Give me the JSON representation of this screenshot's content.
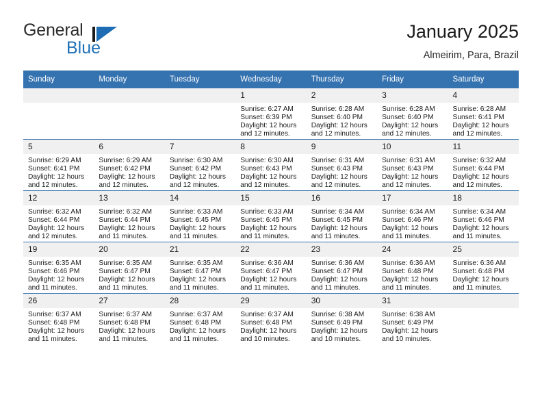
{
  "brand": {
    "name_primary": "General",
    "name_secondary": "Blue",
    "mark_icon": "triangle-flag-icon"
  },
  "header": {
    "title": "January 2025",
    "subtitle": "Almeirim, Para, Brazil"
  },
  "theme": {
    "header_blue": "#3572b0",
    "brand_blue": "#1d70b7",
    "daynum_bg": "#f0f0f0",
    "text": "#1a1a1a"
  },
  "weekday_headers": [
    "Sunday",
    "Monday",
    "Tuesday",
    "Wednesday",
    "Thursday",
    "Friday",
    "Saturday"
  ],
  "weeks": [
    [
      {
        "day": "",
        "blank": true
      },
      {
        "day": "",
        "blank": true
      },
      {
        "day": "",
        "blank": true
      },
      {
        "day": "1",
        "sunrise": "Sunrise: 6:27 AM",
        "sunset": "Sunset: 6:39 PM",
        "daylight": "Daylight: 12 hours and 12 minutes."
      },
      {
        "day": "2",
        "sunrise": "Sunrise: 6:28 AM",
        "sunset": "Sunset: 6:40 PM",
        "daylight": "Daylight: 12 hours and 12 minutes."
      },
      {
        "day": "3",
        "sunrise": "Sunrise: 6:28 AM",
        "sunset": "Sunset: 6:40 PM",
        "daylight": "Daylight: 12 hours and 12 minutes."
      },
      {
        "day": "4",
        "sunrise": "Sunrise: 6:28 AM",
        "sunset": "Sunset: 6:41 PM",
        "daylight": "Daylight: 12 hours and 12 minutes."
      }
    ],
    [
      {
        "day": "5",
        "sunrise": "Sunrise: 6:29 AM",
        "sunset": "Sunset: 6:41 PM",
        "daylight": "Daylight: 12 hours and 12 minutes."
      },
      {
        "day": "6",
        "sunrise": "Sunrise: 6:29 AM",
        "sunset": "Sunset: 6:42 PM",
        "daylight": "Daylight: 12 hours and 12 minutes."
      },
      {
        "day": "7",
        "sunrise": "Sunrise: 6:30 AM",
        "sunset": "Sunset: 6:42 PM",
        "daylight": "Daylight: 12 hours and 12 minutes."
      },
      {
        "day": "8",
        "sunrise": "Sunrise: 6:30 AM",
        "sunset": "Sunset: 6:43 PM",
        "daylight": "Daylight: 12 hours and 12 minutes."
      },
      {
        "day": "9",
        "sunrise": "Sunrise: 6:31 AM",
        "sunset": "Sunset: 6:43 PM",
        "daylight": "Daylight: 12 hours and 12 minutes."
      },
      {
        "day": "10",
        "sunrise": "Sunrise: 6:31 AM",
        "sunset": "Sunset: 6:43 PM",
        "daylight": "Daylight: 12 hours and 12 minutes."
      },
      {
        "day": "11",
        "sunrise": "Sunrise: 6:32 AM",
        "sunset": "Sunset: 6:44 PM",
        "daylight": "Daylight: 12 hours and 12 minutes."
      }
    ],
    [
      {
        "day": "12",
        "sunrise": "Sunrise: 6:32 AM",
        "sunset": "Sunset: 6:44 PM",
        "daylight": "Daylight: 12 hours and 12 minutes."
      },
      {
        "day": "13",
        "sunrise": "Sunrise: 6:32 AM",
        "sunset": "Sunset: 6:44 PM",
        "daylight": "Daylight: 12 hours and 11 minutes."
      },
      {
        "day": "14",
        "sunrise": "Sunrise: 6:33 AM",
        "sunset": "Sunset: 6:45 PM",
        "daylight": "Daylight: 12 hours and 11 minutes."
      },
      {
        "day": "15",
        "sunrise": "Sunrise: 6:33 AM",
        "sunset": "Sunset: 6:45 PM",
        "daylight": "Daylight: 12 hours and 11 minutes."
      },
      {
        "day": "16",
        "sunrise": "Sunrise: 6:34 AM",
        "sunset": "Sunset: 6:45 PM",
        "daylight": "Daylight: 12 hours and 11 minutes."
      },
      {
        "day": "17",
        "sunrise": "Sunrise: 6:34 AM",
        "sunset": "Sunset: 6:46 PM",
        "daylight": "Daylight: 12 hours and 11 minutes."
      },
      {
        "day": "18",
        "sunrise": "Sunrise: 6:34 AM",
        "sunset": "Sunset: 6:46 PM",
        "daylight": "Daylight: 12 hours and 11 minutes."
      }
    ],
    [
      {
        "day": "19",
        "sunrise": "Sunrise: 6:35 AM",
        "sunset": "Sunset: 6:46 PM",
        "daylight": "Daylight: 12 hours and 11 minutes."
      },
      {
        "day": "20",
        "sunrise": "Sunrise: 6:35 AM",
        "sunset": "Sunset: 6:47 PM",
        "daylight": "Daylight: 12 hours and 11 minutes."
      },
      {
        "day": "21",
        "sunrise": "Sunrise: 6:35 AM",
        "sunset": "Sunset: 6:47 PM",
        "daylight": "Daylight: 12 hours and 11 minutes."
      },
      {
        "day": "22",
        "sunrise": "Sunrise: 6:36 AM",
        "sunset": "Sunset: 6:47 PM",
        "daylight": "Daylight: 12 hours and 11 minutes."
      },
      {
        "day": "23",
        "sunrise": "Sunrise: 6:36 AM",
        "sunset": "Sunset: 6:47 PM",
        "daylight": "Daylight: 12 hours and 11 minutes."
      },
      {
        "day": "24",
        "sunrise": "Sunrise: 6:36 AM",
        "sunset": "Sunset: 6:48 PM",
        "daylight": "Daylight: 12 hours and 11 minutes."
      },
      {
        "day": "25",
        "sunrise": "Sunrise: 6:36 AM",
        "sunset": "Sunset: 6:48 PM",
        "daylight": "Daylight: 12 hours and 11 minutes."
      }
    ],
    [
      {
        "day": "26",
        "sunrise": "Sunrise: 6:37 AM",
        "sunset": "Sunset: 6:48 PM",
        "daylight": "Daylight: 12 hours and 11 minutes."
      },
      {
        "day": "27",
        "sunrise": "Sunrise: 6:37 AM",
        "sunset": "Sunset: 6:48 PM",
        "daylight": "Daylight: 12 hours and 11 minutes."
      },
      {
        "day": "28",
        "sunrise": "Sunrise: 6:37 AM",
        "sunset": "Sunset: 6:48 PM",
        "daylight": "Daylight: 12 hours and 11 minutes."
      },
      {
        "day": "29",
        "sunrise": "Sunrise: 6:37 AM",
        "sunset": "Sunset: 6:48 PM",
        "daylight": "Daylight: 12 hours and 10 minutes."
      },
      {
        "day": "30",
        "sunrise": "Sunrise: 6:38 AM",
        "sunset": "Sunset: 6:49 PM",
        "daylight": "Daylight: 12 hours and 10 minutes."
      },
      {
        "day": "31",
        "sunrise": "Sunrise: 6:38 AM",
        "sunset": "Sunset: 6:49 PM",
        "daylight": "Daylight: 12 hours and 10 minutes."
      },
      {
        "day": "",
        "blank": true
      }
    ]
  ]
}
